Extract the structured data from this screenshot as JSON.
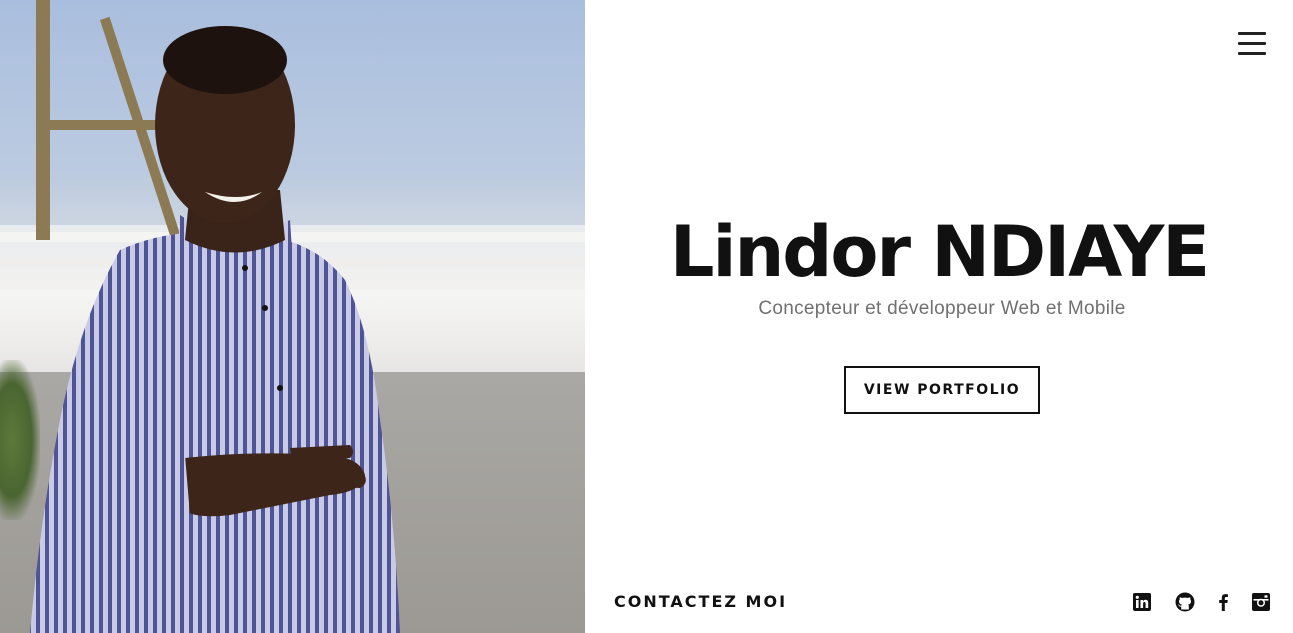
{
  "hero": {
    "name": "Lindor NDIAYE",
    "subtitle": "Concepteur et développeur Web et Mobile",
    "cta_label": "VIEW PORTFOLIO"
  },
  "nav": {
    "menu_icon": "hamburger-menu-icon"
  },
  "footer": {
    "contact_label": "CONTACTEZ MOI",
    "social": [
      {
        "icon": "linkedin-icon"
      },
      {
        "icon": "github-icon"
      },
      {
        "icon": "facebook-icon"
      },
      {
        "icon": "instagram-icon"
      }
    ]
  },
  "colors": {
    "text": "#111111",
    "subtitle": "#707070",
    "background": "#ffffff"
  }
}
